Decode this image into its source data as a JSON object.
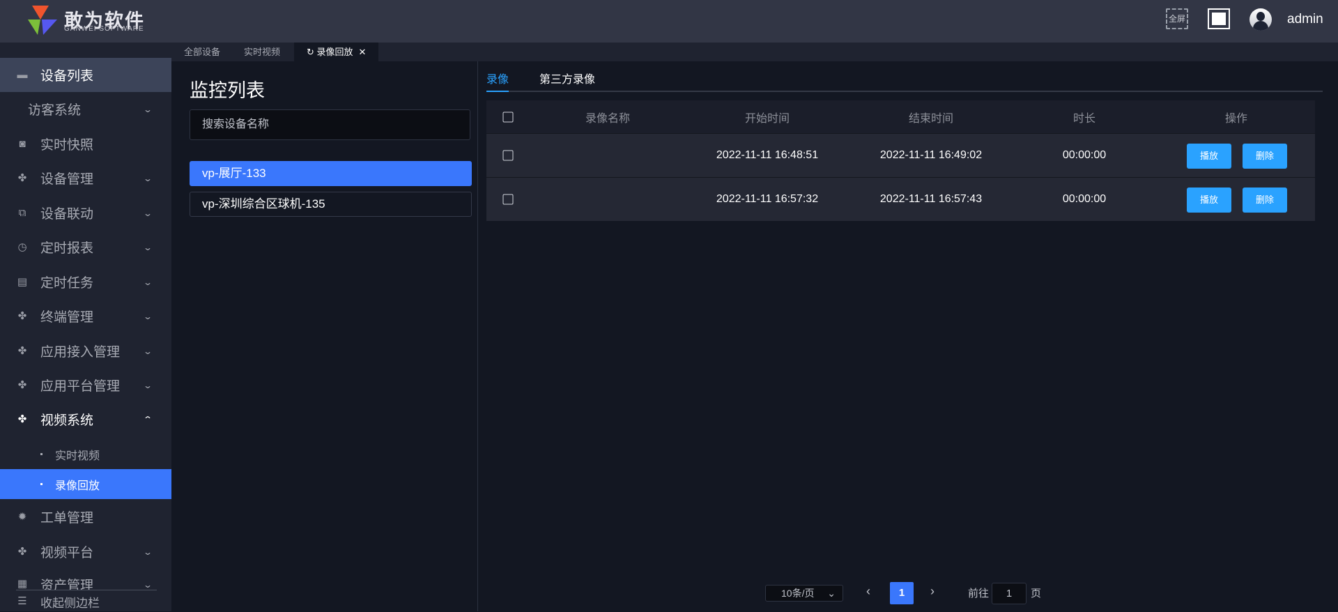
{
  "header": {
    "brand": "敢为软件",
    "brand_sub": "GANWEI SOFTWARE",
    "fullscreen_label": "全屏",
    "user": "admin"
  },
  "sidebar": {
    "items": [
      {
        "label": "设备列表",
        "icon": "monitor-icon"
      },
      {
        "label": "访客系统"
      },
      {
        "label": "实时快照",
        "icon": "camera-icon"
      },
      {
        "label": "设备管理",
        "icon": "grid-icon"
      },
      {
        "label": "设备联动",
        "icon": "link-icon"
      },
      {
        "label": "定时报表",
        "icon": "timer-icon"
      },
      {
        "label": "定时任务",
        "icon": "task-icon"
      },
      {
        "label": "终端管理",
        "icon": "grid-icon"
      },
      {
        "label": "应用接入管理",
        "icon": "grid-icon"
      },
      {
        "label": "应用平台管理",
        "icon": "grid-icon"
      },
      {
        "label": "视频系统",
        "icon": "grid-icon"
      },
      {
        "label": "实时视频"
      },
      {
        "label": "录像回放"
      },
      {
        "label": "工单管理",
        "icon": "gear-icon"
      },
      {
        "label": "视频平台",
        "icon": "grid-icon"
      },
      {
        "label": "资产管理",
        "icon": "asset-icon"
      }
    ],
    "collapse": "收起侧边栏"
  },
  "page_tabs": [
    {
      "label": "全部设备"
    },
    {
      "label": "实时视频"
    },
    {
      "label": "录像回放"
    }
  ],
  "monitor": {
    "title": "监控列表",
    "search_placeholder": "搜索设备名称",
    "devices": [
      "vp-展厅-133",
      "vp-深圳综合区球机-135"
    ]
  },
  "record_tabs": [
    "录像",
    "第三方录像"
  ],
  "table": {
    "headers": [
      "录像名称",
      "开始时间",
      "结束时间",
      "时长",
      "操作"
    ],
    "rows": [
      {
        "name": "",
        "start": "2022-11-11 16:48:51",
        "end": "2022-11-11 16:49:02",
        "duration": "00:00:00"
      },
      {
        "name": "",
        "start": "2022-11-11 16:57:32",
        "end": "2022-11-11 16:57:43",
        "duration": "00:00:00"
      }
    ],
    "play": "播放",
    "delete": "删除"
  },
  "pagination": {
    "page_size": "10条/页",
    "current": "1",
    "goto_label": "前往",
    "goto_value": "1",
    "page_suffix": "页"
  },
  "colors": {
    "accent": "#3a77fc",
    "button": "#2aa2ff",
    "header": "#323645",
    "sidebar": "#1f2330"
  }
}
